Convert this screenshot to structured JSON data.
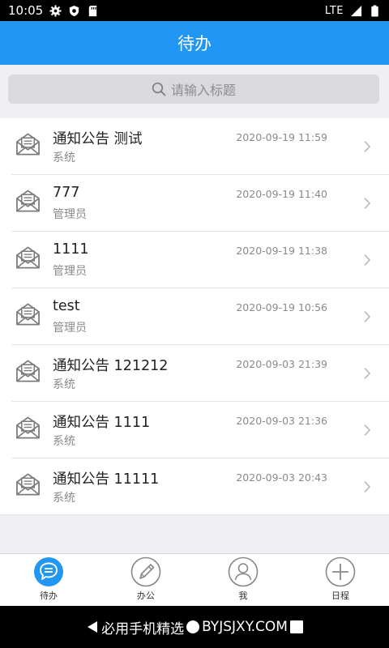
{
  "status_bar": {
    "time": "10:05",
    "network": "LTE",
    "icons": [
      "gear-icon",
      "shield-icon",
      "sdcard-icon",
      "signal-icon",
      "battery-icon"
    ]
  },
  "header": {
    "title": "待办"
  },
  "search": {
    "placeholder": "请输入标题"
  },
  "items": [
    {
      "title": "通知公告 测试",
      "subtitle": "系统",
      "date": "2020-09-19 11:59"
    },
    {
      "title": "777",
      "subtitle": "管理员",
      "date": "2020-09-19 11:40"
    },
    {
      "title": "1111",
      "subtitle": "管理员",
      "date": "2020-09-19 11:38"
    },
    {
      "title": "test",
      "subtitle": "管理员",
      "date": "2020-09-19 10:56"
    },
    {
      "title": "通知公告 121212",
      "subtitle": "系统",
      "date": "2020-09-03 21:39"
    },
    {
      "title": "通知公告 1111",
      "subtitle": "系统",
      "date": "2020-09-03 21:36"
    },
    {
      "title": "通知公告 11111",
      "subtitle": "系统",
      "date": "2020-09-03 20:43"
    }
  ],
  "tabs": [
    {
      "label": "待办",
      "icon": "chat-bubble-icon",
      "active": true
    },
    {
      "label": "办公",
      "icon": "pencil-icon",
      "active": false
    },
    {
      "label": "我",
      "icon": "user-icon",
      "active": false
    },
    {
      "label": "日程",
      "icon": "plus-icon",
      "active": false
    }
  ],
  "nav_bar": {
    "watermark": "必用手机精选",
    "watermark_site": "BYJSJXY.COM"
  },
  "colors": {
    "primary": "#2196f3",
    "background": "#efeff4",
    "icon_gray": "#8a8a8a"
  }
}
